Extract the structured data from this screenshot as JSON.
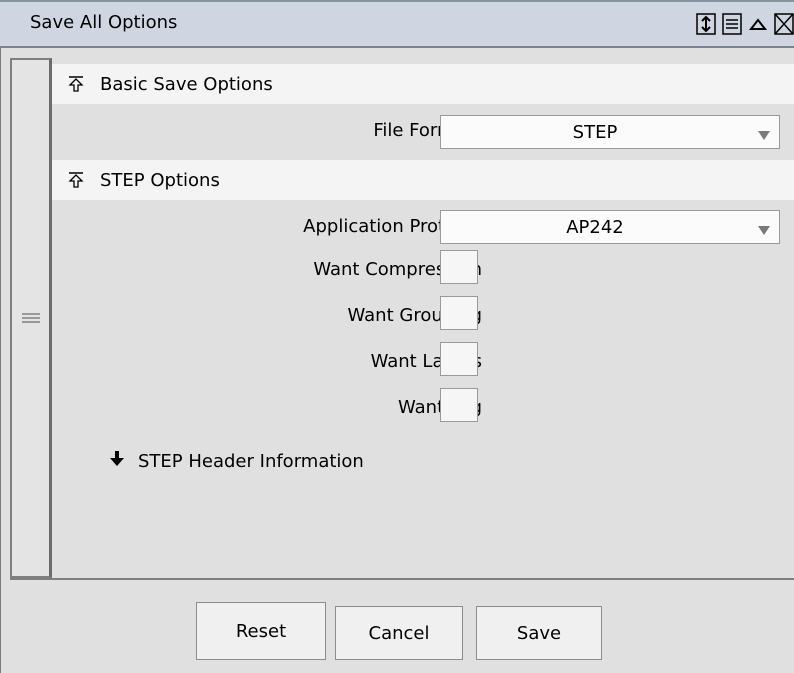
{
  "window": {
    "title": "Save All Options"
  },
  "titlebar_icons": [
    "resize-vertical-icon",
    "list-icon",
    "collapse-up-icon",
    "close-icon"
  ],
  "sections": {
    "basic": {
      "title": "Basic Save Options",
      "file_formats_label": "File Formats",
      "file_formats_value": "STEP"
    },
    "step": {
      "title": "STEP Options",
      "app_protocol_label": "Application Protocol",
      "app_protocol_value": "AP242",
      "want_compression_label": "Want Compression",
      "want_grouping_label": "Want Grouping",
      "want_layers_label": "Want Layers",
      "want_log_label": "Want Log",
      "checkboxes": {
        "compression": false,
        "grouping": false,
        "layers": false,
        "log": false
      }
    },
    "header_info": {
      "label": "STEP Header Information",
      "expanded": false
    }
  },
  "buttons": {
    "reset": "Reset",
    "cancel": "Cancel",
    "save": "Save"
  }
}
